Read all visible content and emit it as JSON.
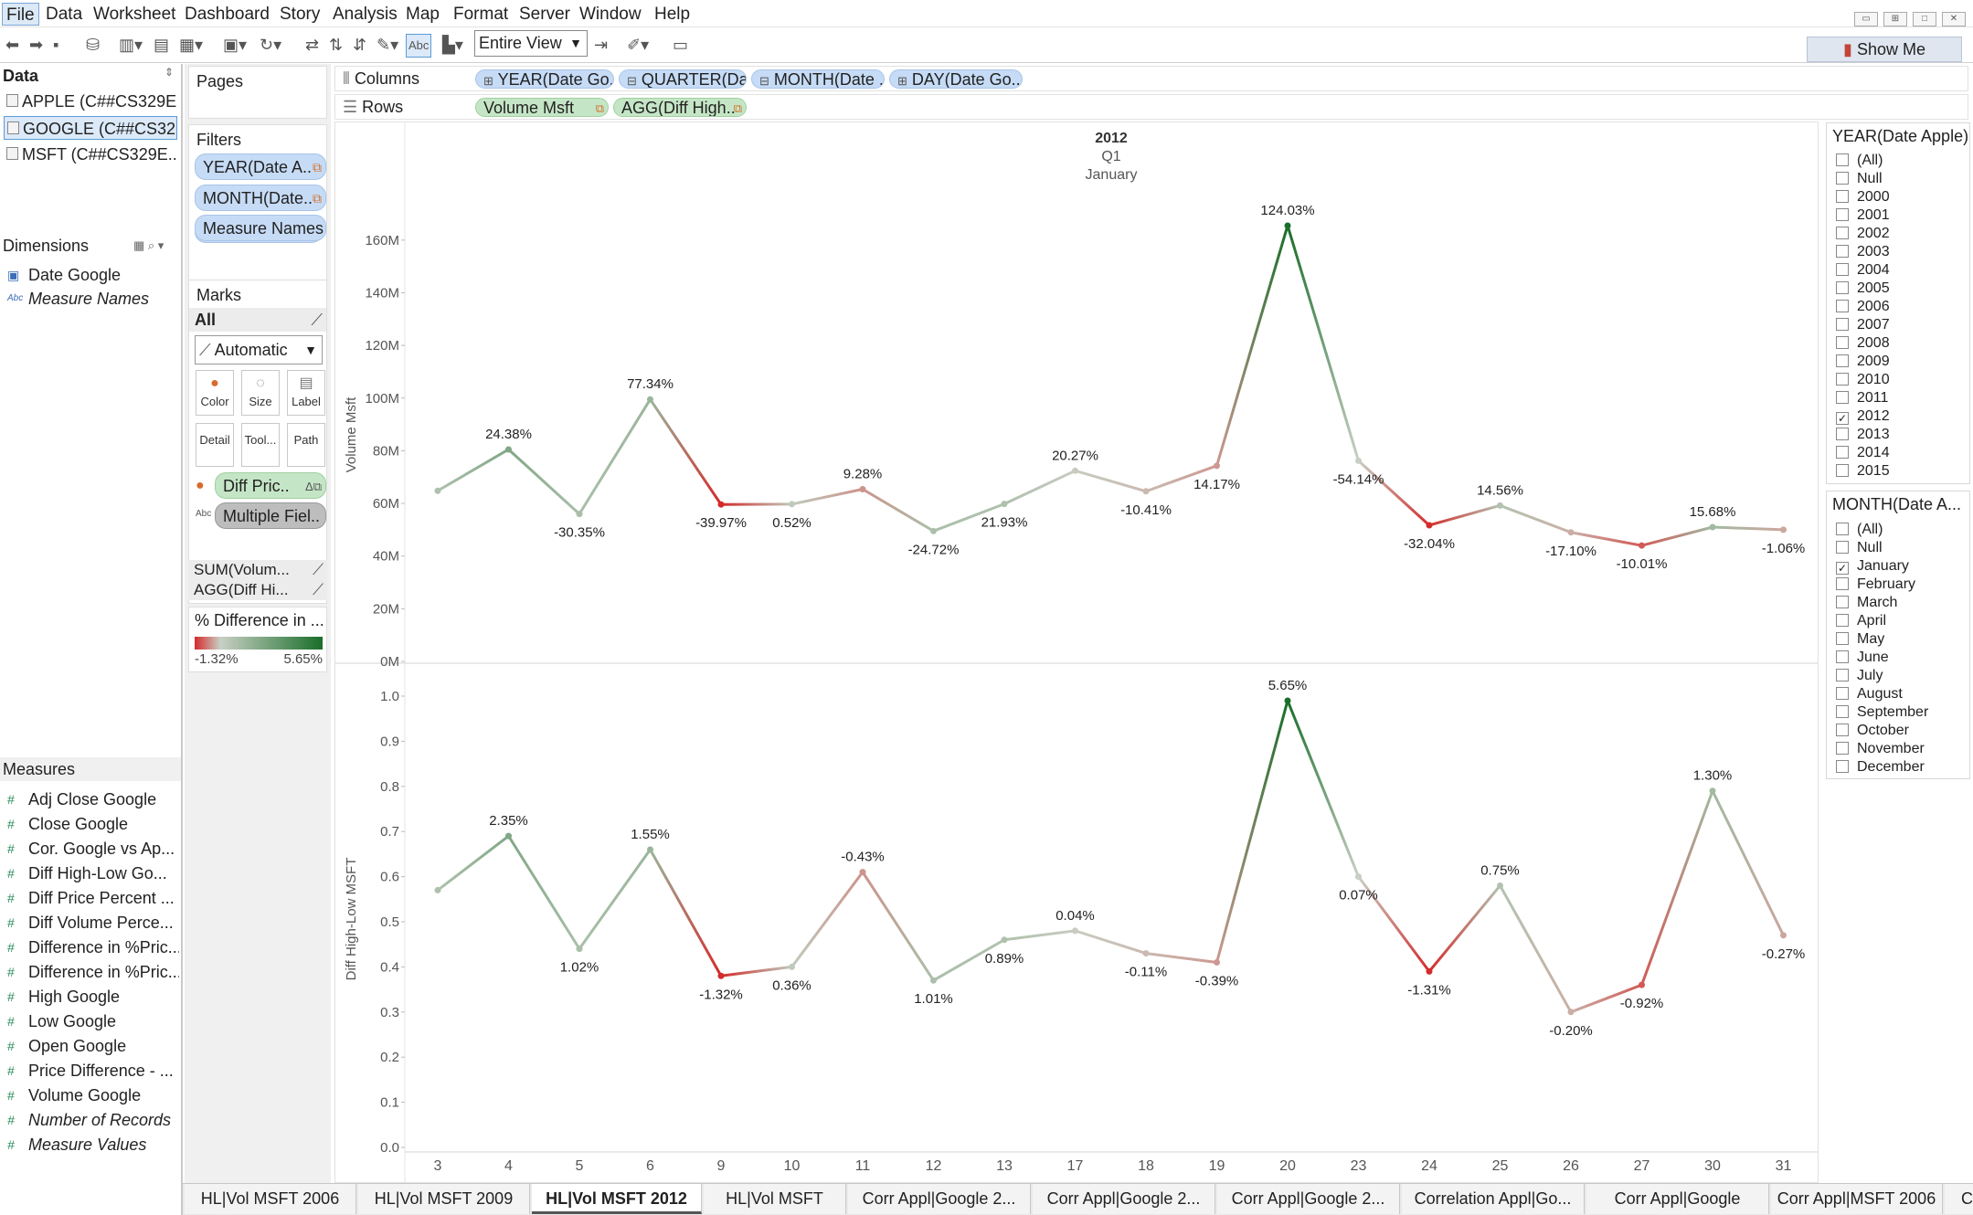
{
  "menu": [
    "File",
    "Data",
    "Worksheet",
    "Dashboard",
    "Story",
    "Analysis",
    "Map",
    "Format",
    "Server",
    "Window",
    "Help"
  ],
  "toolbar": {
    "view_mode": "Entire View",
    "show_me": "Show Me",
    "abc": "Abc"
  },
  "data_pane": {
    "title": "Data",
    "sources": [
      "APPLE (C##CS329E...",
      "GOOGLE (C##CS32...",
      "MSFT (C##CS329E..."
    ],
    "dimensions_title": "Dimensions",
    "dimensions": [
      "Date Google",
      "Measure Names"
    ],
    "measures_title": "Measures",
    "measures": [
      "Adj Close Google",
      "Close Google",
      "Cor. Google vs Ap...",
      "Diff High-Low Go...",
      "Diff Price Percent ...",
      "Diff Volume Perce...",
      "Difference in %Pric...",
      "Difference in %Pric...",
      "High Google",
      "Low Google",
      "Open Google",
      "Price Difference - ...",
      "Volume Google",
      "Number of Records",
      "Measure Values"
    ]
  },
  "shelves": {
    "pages": "Pages",
    "filters": "Filters",
    "filter_pills": [
      "YEAR(Date A..",
      "MONTH(Date..",
      "Measure Names"
    ],
    "marks": "Marks",
    "marks_all": "All",
    "mark_type": "Automatic",
    "mark_buttons": [
      "Color",
      "Size",
      "Label",
      "Detail",
      "Tool...",
      "Path"
    ],
    "mark_pills": [
      "Diff Pric..",
      "Multiple Fiel.."
    ],
    "mark_sections": [
      "SUM(Volum...",
      "AGG(Diff Hi..."
    ],
    "legend_title": "% Difference in ...",
    "legend_min": "-1.32%",
    "legend_max": "5.65%",
    "columns_label": "Columns",
    "rows_label": "Rows",
    "columns": [
      "YEAR(Date Go..",
      "QUARTER(Dat..",
      "MONTH(Date ..",
      "DAY(Date Go.."
    ],
    "rows": [
      "Volume Msft",
      "AGG(Diff High.."
    ]
  },
  "header": {
    "year": "2012",
    "quarter": "Q1",
    "month": "January"
  },
  "chart_data": {
    "type": "line",
    "x": [
      "3",
      "4",
      "5",
      "6",
      "9",
      "10",
      "11",
      "12",
      "13",
      "17",
      "18",
      "19",
      "20",
      "23",
      "24",
      "25",
      "26",
      "27",
      "30",
      "31"
    ],
    "color_range": [
      -1.32,
      5.65
    ],
    "colors": {
      "low": "#d42a2a",
      "mid": "#c8cfc4",
      "high": "#1a6e2a"
    },
    "panes": [
      {
        "ylabel": "Volume Msft",
        "ylim": [
          0,
          170000000
        ],
        "ticks": [
          "0M",
          "20M",
          "40M",
          "60M",
          "80M",
          "100M",
          "120M",
          "140M",
          "160M"
        ],
        "values": [
          64800000,
          80500000,
          56000000,
          99500000,
          59600000,
          59700000,
          65400000,
          49500000,
          59800000,
          72400000,
          64600000,
          74300000,
          165500000,
          76200000,
          51700000,
          59200000,
          49000000,
          44000000,
          51000000,
          50000000
        ],
        "labels": [
          "",
          "24.38%",
          "-30.35%",
          "77.34%",
          "-39.97%",
          "0.52%",
          "9.28%",
          "-24.72%",
          "21.93%",
          "20.27%",
          "-10.41%",
          "14.17%",
          "124.03%",
          "-54.14%",
          "-32.04%",
          "14.56%",
          "-17.10%",
          "-10.01%",
          "15.68%",
          "-1.06%"
        ]
      },
      {
        "ylabel": "Diff High-Low MSFT",
        "ylim": [
          0,
          1.0
        ],
        "ticks": [
          "0.0",
          "0.1",
          "0.2",
          "0.3",
          "0.4",
          "0.5",
          "0.6",
          "0.7",
          "0.8",
          "0.9",
          "1.0"
        ],
        "values": [
          0.57,
          0.69,
          0.44,
          0.66,
          0.38,
          0.4,
          0.61,
          0.37,
          0.46,
          0.48,
          0.43,
          0.41,
          0.99,
          0.6,
          0.39,
          0.58,
          0.3,
          0.36,
          0.79,
          0.47
        ],
        "labels": [
          "",
          "2.35%",
          "1.02%",
          "1.55%",
          "-1.32%",
          "0.36%",
          "-0.43%",
          "1.01%",
          "0.89%",
          "0.04%",
          "-0.11%",
          "-0.39%",
          "5.65%",
          "0.07%",
          "-1.31%",
          "0.75%",
          "-0.20%",
          "-0.92%",
          "1.30%",
          "-0.27%"
        ]
      }
    ],
    "color_values": [
      0.9,
      2.35,
      1.02,
      1.55,
      -1.32,
      0.36,
      -0.43,
      1.01,
      0.89,
      0.04,
      -0.11,
      -0.39,
      5.65,
      0.07,
      -1.31,
      0.75,
      -0.2,
      -0.92,
      1.3,
      -0.27
    ]
  },
  "filters": {
    "year": {
      "title": "YEAR(Date Apple)",
      "options": [
        "(All)",
        "Null",
        "2000",
        "2001",
        "2002",
        "2003",
        "2004",
        "2005",
        "2006",
        "2007",
        "2008",
        "2009",
        "2010",
        "2011",
        "2012",
        "2013",
        "2014",
        "2015"
      ],
      "checked": [
        "2012"
      ]
    },
    "month": {
      "title": "MONTH(Date A...",
      "options": [
        "(All)",
        "Null",
        "January",
        "February",
        "March",
        "April",
        "May",
        "June",
        "July",
        "August",
        "September",
        "October",
        "November",
        "December"
      ],
      "checked": [
        "January"
      ]
    }
  },
  "tabs": [
    "HL|Vol MSFT 2006",
    "HL|Vol MSFT 2009",
    "HL|Vol MSFT 2012",
    "HL|Vol MSFT",
    "Corr Appl|Google 2...",
    "Corr Appl|Google 2...",
    "Corr Appl|Google 2...",
    "Correlation Appl|Go...",
    "Corr Appl|Google",
    "Corr Appl|MSFT 2006",
    "Co"
  ],
  "active_tab": "HL|Vol MSFT 2012"
}
